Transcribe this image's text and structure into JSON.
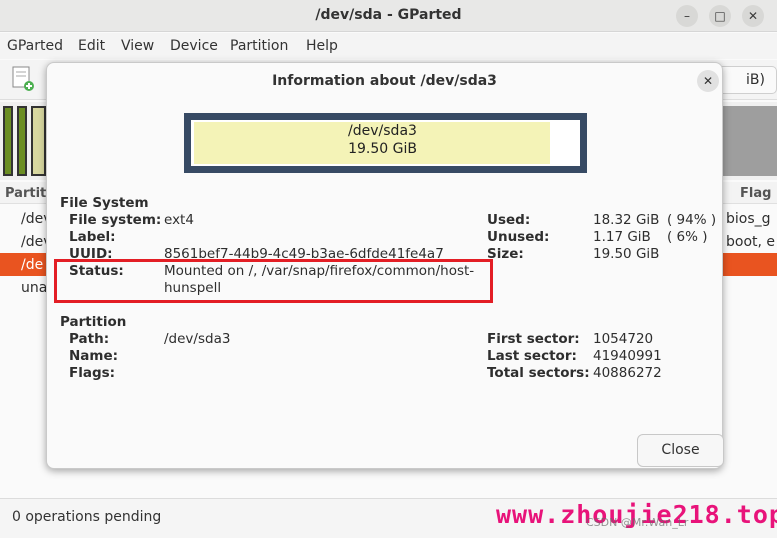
{
  "window": {
    "title": "/dev/sda - GParted"
  },
  "menu": [
    "GParted",
    "Edit",
    "View",
    "Device",
    "Partition",
    "Help"
  ],
  "device_selector": {
    "visible_text": "iB)"
  },
  "partition_list": {
    "col_partition": "Partit",
    "col_flags": "Flag",
    "rows": [
      {
        "partition": "/dev",
        "flags": "bios_g"
      },
      {
        "partition": "/dev",
        "flags": "boot, e"
      },
      {
        "partition": "/de",
        "flags": ""
      },
      {
        "partition": "una",
        "flags": ""
      }
    ]
  },
  "statusbar": {
    "pending": "0 operations pending"
  },
  "watermark": {
    "text": "www.zhoujie218.top",
    "csdn": "CSDN @Mr.Wan_Lr"
  },
  "dialog": {
    "title": "Information about /dev/sda3",
    "graph": {
      "name": "/dev/sda3",
      "size": "19.50 GiB",
      "used_fraction": 0.94
    },
    "filesystem": {
      "heading": "File System",
      "labels": {
        "fs": "File system:",
        "label": "Label:",
        "uuid": "UUID:",
        "status": "Status:"
      },
      "fs": "ext4",
      "label": "",
      "uuid": "8561bef7-44b9-4c49-b3ae-6dfde41fe4a7",
      "status_line1": "Mounted on /, /var/snap/firefox/common/host-",
      "status_line2": "hunspell",
      "usage_labels": {
        "used": "Used:",
        "unused": "Unused:",
        "size": "Size:"
      },
      "used": "18.32 GiB",
      "used_pct": "( 94% )",
      "unused": "1.17 GiB",
      "unused_pct": "( 6% )",
      "size": "19.50 GiB"
    },
    "partition": {
      "heading": "Partition",
      "labels": {
        "path": "Path:",
        "name": "Name:",
        "flags": "Flags:"
      },
      "path": "/dev/sda3",
      "name": "",
      "flags": "",
      "sector_labels": {
        "first": "First sector:",
        "last": "Last sector:",
        "total": "Total sectors:"
      },
      "first_sector": "1054720",
      "last_sector": "41940991",
      "total_sectors": "40886272"
    },
    "close_label": "Close"
  }
}
